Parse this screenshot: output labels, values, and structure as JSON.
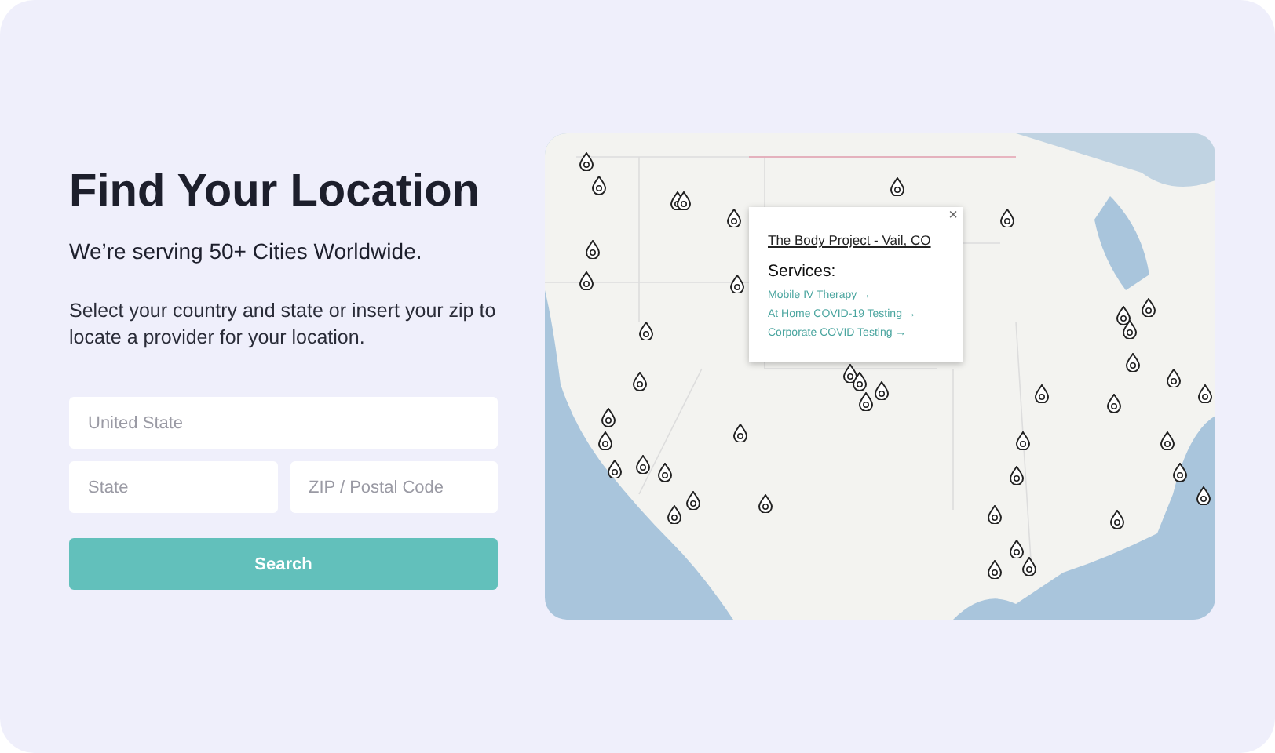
{
  "heading": "Find Your Location",
  "tagline": "We’re serving 50+ Cities Worldwide.",
  "description": "Select your country and state or insert your zip to locate a provider for your location.",
  "fields": [
    {
      "placeholder": "United State"
    },
    {
      "placeholder": "State"
    },
    {
      "placeholder": "ZIP / Postal Code"
    }
  ],
  "search_button": "Search",
  "map_popup": {
    "close": "×",
    "title": "The Body Project - Vail, CO",
    "subtitle": "Services:",
    "links": [
      "Mobile IV Therapy →",
      "At Home COVID-19 Testing →",
      "Corporate COVID Testing →"
    ]
  }
}
